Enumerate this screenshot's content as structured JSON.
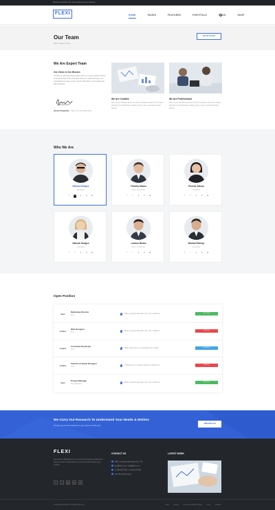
{
  "topbar": {
    "text": "Welcome to FLEXI. The multi solution for your business"
  },
  "header": {
    "logo": "FLEXI",
    "nav": [
      "HOME",
      "PAGES",
      "FEATURES",
      "PORTFOLIO",
      "BLOG",
      "SHOP"
    ]
  },
  "pagehead": {
    "title": "Our Team",
    "breadcrumb": "Home / Pages / Team",
    "button": "GET IN TOUCH"
  },
  "about": {
    "heading": "We Are Expert Team",
    "subheading": "Our Vision & Our Mission",
    "text": "Contact us with any queries about Flexi or to your product service, or business field. The consultant comes for quick and grow, our consultants are easy to get in touch. We listen to your goals and offer solutions.",
    "signer": "Jessie Carpenter",
    "signer_role": " - CEO / Co-Founder Flexi",
    "features": [
      {
        "title": "We Are Creative",
        "text": "Flexi is your ultimate all-in-one tool for businesses across the board, whether it is advertising or selling, easy to use, everything design agency."
      },
      {
        "title": "We Are Professional",
        "text": "Flexi is your ultimate all-in-one tool for businesses across the board, whether it is advertising or selling, easy to use, everything design agency."
      }
    ]
  },
  "who": {
    "heading": "Who We Are",
    "members": [
      {
        "name": "William Bridges",
        "role": "Developer"
      },
      {
        "name": "Timothy Mason",
        "role": "CEO / Co-Founder"
      },
      {
        "name": "Phoebe Allison",
        "role": "President"
      },
      {
        "name": "Hannah Hodges",
        "role": "Consultant"
      },
      {
        "name": "Landon Banks",
        "role": "CEO / Co-Founder"
      },
      {
        "name": "Michael Bishop",
        "role": "Consultant"
      }
    ]
  },
  "jobs": {
    "heading": "Open Position",
    "items": [
      {
        "logo": "flexi",
        "title": "Marketing Director",
        "company": "Flexi",
        "location": "5801 Lexington Mountains Apt. 730, California",
        "badge": "Part Time",
        "color": "#4cb963"
      },
      {
        "logo": "Amaze",
        "title": "Web Designer",
        "company": "Flexi",
        "location": "5801 Lexington Mountains Apt. 730, California",
        "badge": "Full Time",
        "color": "#e9474c"
      },
      {
        "logo": "Amaze",
        "title": "Front End Developer",
        "company": "Flexi",
        "location": "5801 Wintonside St, Lake Elsie North, 30007",
        "badge": "Freelance",
        "color": "#44a5e6"
      },
      {
        "logo": "Amaze",
        "title": "Fashion & Stylist Designer",
        "company": "Flexi",
        "location": "7/8 Martlow St, Cottleton Mayland, 30003 Nev",
        "badge": "Full Time",
        "color": "#e9474c"
      },
      {
        "logo": "flexi",
        "title": "Project Manager",
        "company": "Flexi Magazine",
        "location": "5801 Lexington Mountains Apt. 730, California",
        "badge": "Part Time",
        "color": "#4cb963"
      }
    ]
  },
  "cta": {
    "heading": "We Carry Out Research To Understand Your Needs & Wishes",
    "sub": "Provide you the best solutions for your business all the time.",
    "button": "JOIN WITH US"
  },
  "footer": {
    "logo": "FLEXI",
    "about": "Consectetur adipisicing elit, sed do eiusmod tempor incididunt ut labore et dolore magna aliqua. Ut enim ad minim veniam quis nostrud.",
    "social": [
      "f",
      "t",
      "g+",
      "in",
      "yt"
    ],
    "contact_heading": "CONTACT US",
    "contact": [
      "5801 Lexington Mountains Apt. 730",
      "info@flexi.com  /  mail@flexi.com",
      "+1 800 567 890  /  +1 800 678 456",
      "www.flexi-theme.com"
    ],
    "work_heading": "LATEST WORK",
    "copyright": "Copyright 2019 FLEXI. All Right Reserved.",
    "links": [
      "Home",
      "Privacy",
      "Terms & Condition Privacy",
      "F.A.Q.",
      "Contact"
    ]
  }
}
